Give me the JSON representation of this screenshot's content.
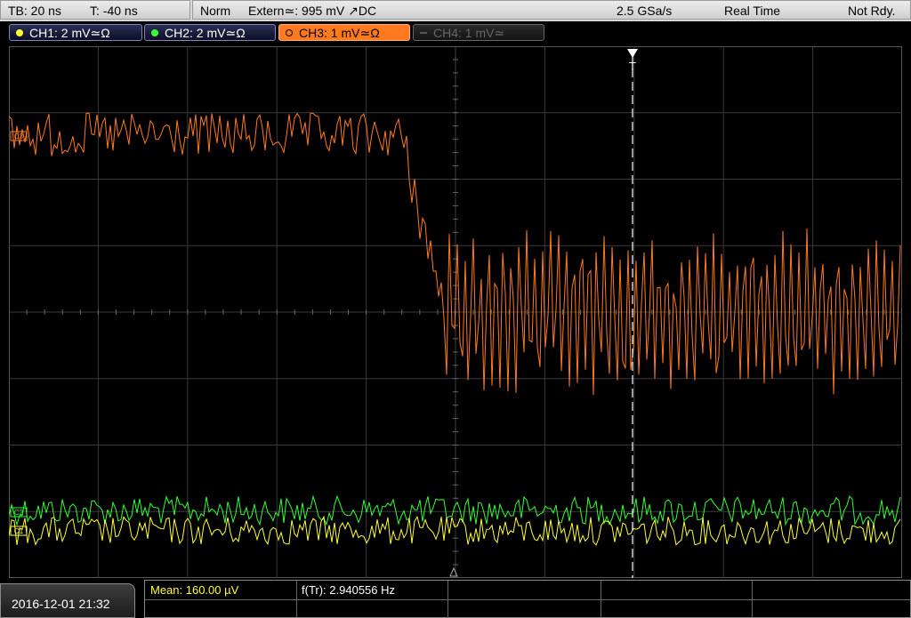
{
  "status": {
    "timebase": "TB: 20 ns",
    "trigger_pos": "T: -40 ns",
    "mode": "Norm",
    "trigger_source": "Extern≃: 995 mV ↗DC",
    "sample_rate": "2.5 GSa/s",
    "acq_mode": "Real Time",
    "state": "Not Rdy."
  },
  "channels": [
    {
      "label": "CH1: 2 mV≃Ω",
      "color": "#ffff33"
    },
    {
      "label": "CH2: 2 mV≃Ω",
      "color": "#33ff33"
    },
    {
      "label": "CH3: 1 mV≃Ω",
      "color": "#ff7a1e"
    },
    {
      "label": "CH4: 1 mV≃",
      "color": "#666666"
    }
  ],
  "trigger_marker": "T",
  "ref_markers": {
    "ch3": "C3",
    "ch2": "C2",
    "ch1": "C1"
  },
  "measurements": {
    "mean": "Mean: 160.00 µV",
    "freq": "f(Tr): 2.940556 Hz"
  },
  "datetime": "2016-12-01 21:32",
  "colors": {
    "ch1": "#ffff33",
    "ch2": "#33ff33",
    "ch3": "#ff7a1e",
    "grid": "#3a3a3a"
  }
}
